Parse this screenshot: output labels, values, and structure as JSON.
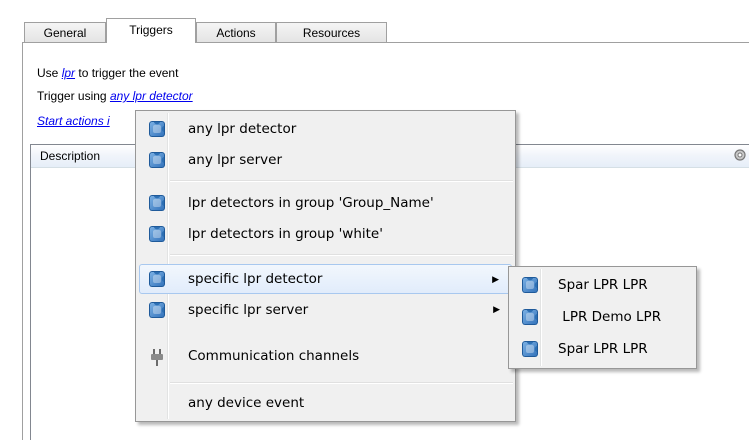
{
  "tabs": [
    {
      "label": "General"
    },
    {
      "label": "Triggers"
    },
    {
      "label": "Actions"
    },
    {
      "label": "Resources"
    }
  ],
  "trigger_panel": {
    "use_prefix": "Use",
    "use_link": "lpr",
    "use_suffix": "to trigger the event",
    "trigger_using_prefix": "Trigger using",
    "trigger_using_link": "any lpr detector",
    "start_actions_link": "Start actions i",
    "description_header": "Description"
  },
  "context_menu": {
    "items": [
      {
        "label": "any lpr detector",
        "icon": "puzzle-icon"
      },
      {
        "label": "any lpr server",
        "icon": "puzzle-icon"
      },
      {
        "label": "lpr detectors in group 'Group_Name'",
        "icon": "puzzle-icon"
      },
      {
        "label": "lpr detectors in group 'white'",
        "icon": "puzzle-icon"
      },
      {
        "label": "specific lpr detector",
        "icon": "puzzle-icon",
        "submenu": true,
        "highlighted": true
      },
      {
        "label": "specific lpr server",
        "icon": "puzzle-icon",
        "submenu": true
      },
      {
        "label": "Communication channels",
        "icon": "plug-icon"
      },
      {
        "label": "any device event",
        "icon": ""
      }
    ]
  },
  "submenu": {
    "items": [
      {
        "label": "Spar LPR LPR",
        "icon": "puzzle-icon"
      },
      {
        "label": " LPR Demo LPR",
        "icon": "puzzle-icon"
      },
      {
        "label": "Spar LPR LPR",
        "icon": "puzzle-icon"
      }
    ]
  },
  "colors": {
    "link": "#0000ee",
    "menu_bg": "#f0f0f0",
    "highlight_border": "#a8c8ef"
  }
}
